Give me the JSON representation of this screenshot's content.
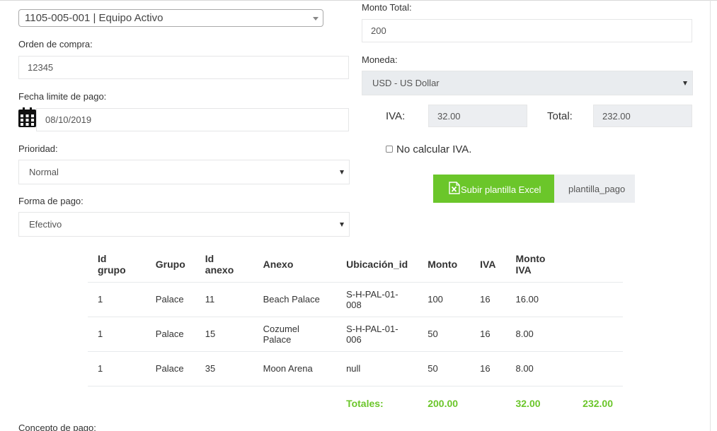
{
  "account_select": {
    "value": "1105-005-001 | Equipo Activo"
  },
  "orden_compra": {
    "label": "Orden de compra:",
    "value": "12345"
  },
  "fecha_limite": {
    "label": "Fecha limite de pago:",
    "value": "08/10/2019"
  },
  "prioridad": {
    "label": "Prioridad:",
    "value": "Normal"
  },
  "forma_pago": {
    "label": "Forma de pago:",
    "value": "Efectivo"
  },
  "monto_total": {
    "label": "Monto Total:",
    "value": "200"
  },
  "moneda": {
    "label": "Moneda:",
    "value": "USD - US Dollar"
  },
  "iva": {
    "label": "IVA:",
    "value": "32.00"
  },
  "total": {
    "label": "Total:",
    "value": "232.00"
  },
  "no_calcular_iva": {
    "label": "No calcular IVA.",
    "checked": false
  },
  "upload": {
    "button_label": "Subir plantilla Excel",
    "file_name": "plantilla_pago"
  },
  "table": {
    "headers": [
      "Id grupo",
      "Grupo",
      "Id anexo",
      "Anexo",
      "Ubicación_id",
      "Monto",
      "IVA",
      "Monto IVA"
    ],
    "rows": [
      [
        "1",
        "Palace",
        "11",
        "Beach Palace",
        "S-H-PAL-01-008",
        "100",
        "16",
        "16.00"
      ],
      [
        "1",
        "Palace",
        "15",
        "Cozumel Palace",
        "S-H-PAL-01-006",
        "50",
        "16",
        "8.00"
      ],
      [
        "1",
        "Palace",
        "35",
        "Moon Arena",
        "null",
        "50",
        "16",
        "8.00"
      ]
    ],
    "totals": {
      "label": "Totales:",
      "monto": "200.00",
      "iva": "32.00",
      "total": "232.00"
    }
  },
  "concepto": {
    "label": "Concepto de pago:"
  },
  "colors": {
    "accent_green": "#6bc62a",
    "input_gray": "#eceef1"
  }
}
